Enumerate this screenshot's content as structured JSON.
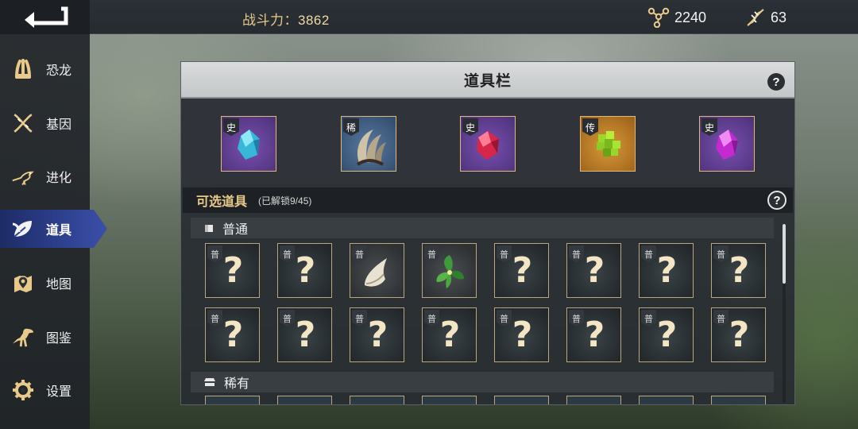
{
  "topbar": {
    "power_label": "战斗力：",
    "power_value": "3862",
    "resource1_value": "2240",
    "resource1_icon": "molecule-icon",
    "resource2_value": "63",
    "resource2_icon": "dna-icon"
  },
  "sidebar": {
    "items": [
      {
        "label": "恐龙",
        "icon": "claw-icon"
      },
      {
        "label": "基因",
        "icon": "dna-icon"
      },
      {
        "label": "进化",
        "icon": "bird-icon"
      },
      {
        "label": "道具",
        "icon": "leaf-icon",
        "active": true
      },
      {
        "label": "地图",
        "icon": "map-pin-icon"
      },
      {
        "label": "图鉴",
        "icon": "dinosaur-icon"
      },
      {
        "label": "设置",
        "icon": "gear-icon"
      }
    ]
  },
  "panel": {
    "title": "道具栏",
    "help": "?",
    "equipped": [
      {
        "tag": "史",
        "item": "blue-crystal",
        "bg": "#5b3f8a"
      },
      {
        "tag": "稀",
        "item": "dinosaur-claw",
        "bg": "#3b5a80"
      },
      {
        "tag": "史",
        "item": "red-crystal",
        "bg": "#5b3f8a"
      },
      {
        "tag": "传",
        "item": "green-crystal",
        "bg": "#b8761f"
      },
      {
        "tag": "史",
        "item": "magenta-crystal",
        "bg": "#5b3f8a"
      }
    ],
    "optional_title": "可选道具",
    "optional_count": "(已解锁9/45)",
    "categories": [
      {
        "name": "普通",
        "icon": "box-icon",
        "rows": [
          [
            {
              "tag": "普",
              "item": "?"
            },
            {
              "tag": "普",
              "item": "?"
            },
            {
              "tag": "普",
              "item": "tooth"
            },
            {
              "tag": "普",
              "item": "herb"
            },
            {
              "tag": "普",
              "item": "?"
            },
            {
              "tag": "普",
              "item": "?"
            },
            {
              "tag": "普",
              "item": "?"
            },
            {
              "tag": "普",
              "item": "?"
            }
          ],
          [
            {
              "tag": "普",
              "item": "?"
            },
            {
              "tag": "普",
              "item": "?"
            },
            {
              "tag": "普",
              "item": "?"
            },
            {
              "tag": "普",
              "item": "?"
            },
            {
              "tag": "普",
              "item": "?"
            },
            {
              "tag": "普",
              "item": "?"
            },
            {
              "tag": "普",
              "item": "?"
            },
            {
              "tag": "普",
              "item": "?"
            }
          ]
        ]
      },
      {
        "name": "稀有",
        "icon": "stack-icon"
      }
    ]
  },
  "colors": {
    "accent_gold": "#e8c989",
    "active_nav": "#2d3f8c",
    "cell_border": "#bda57c"
  }
}
